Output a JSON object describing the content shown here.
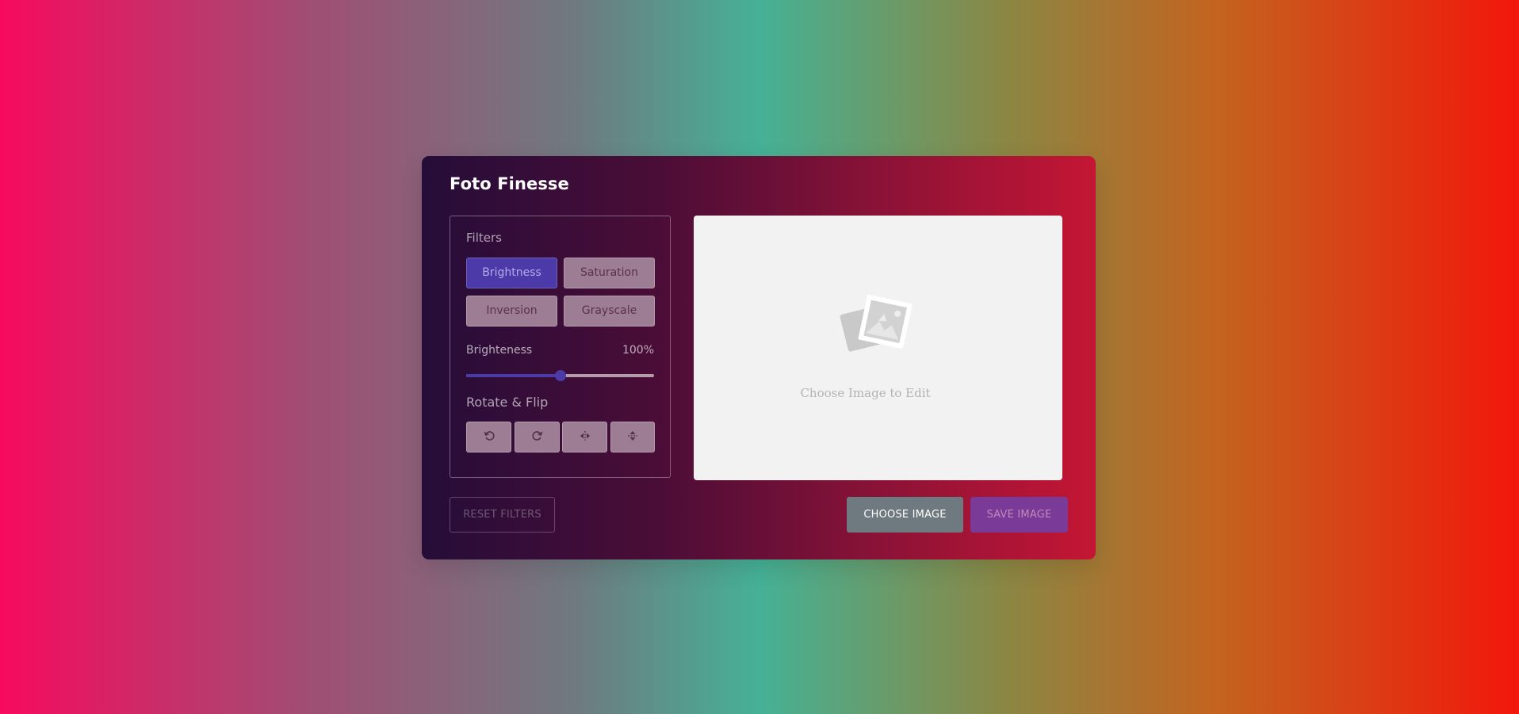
{
  "app": {
    "title": "Foto Finesse"
  },
  "filters": {
    "label": "Filters",
    "buttons": [
      "Brightness",
      "Saturation",
      "Inversion",
      "Grayscale"
    ],
    "active": "Brightness"
  },
  "slider": {
    "name": "Brighteness",
    "value_text": "100%",
    "value": 100,
    "min": 0,
    "max": 200,
    "accent_color": "#4b3aa8"
  },
  "rotate": {
    "label": "Rotate & Flip",
    "icons": [
      "rotate-left-icon",
      "rotate-right-icon",
      "flip-horizontal-icon",
      "flip-vertical-icon"
    ]
  },
  "preview": {
    "placeholder_text": "Choose Image to Edit",
    "icon": "image-placeholder-icon"
  },
  "actions": {
    "reset": "RESET FILTERS",
    "choose": "CHOOSE IMAGE",
    "save": "SAVE IMAGE"
  }
}
